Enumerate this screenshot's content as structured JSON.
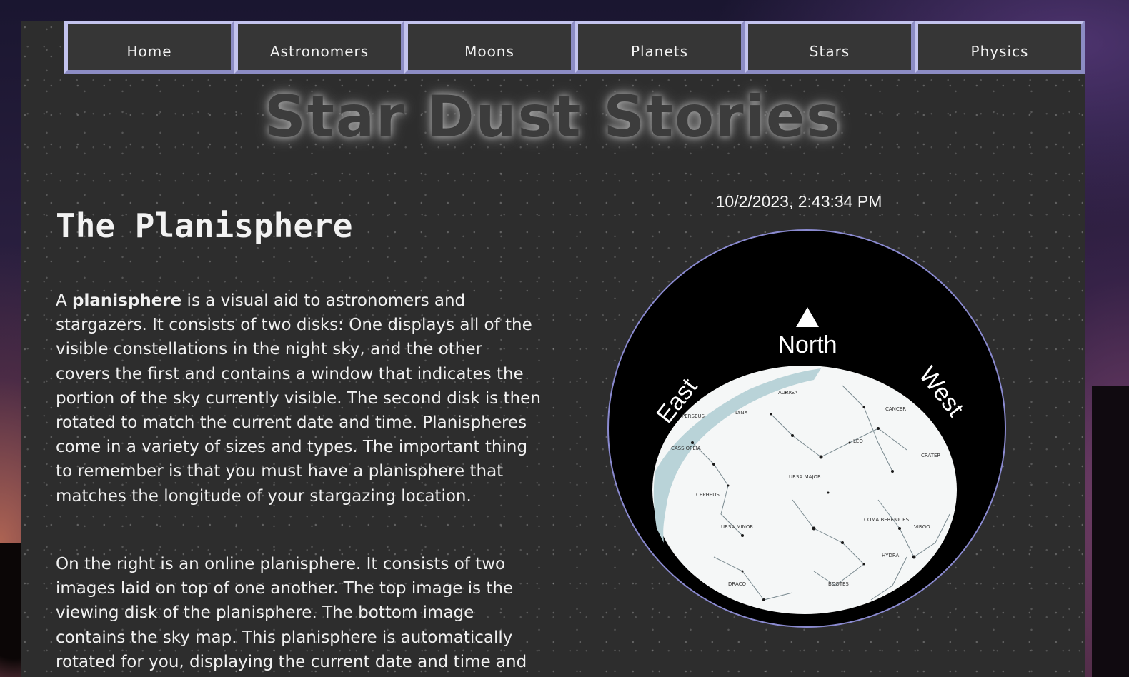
{
  "nav": {
    "items": [
      {
        "label": "Home"
      },
      {
        "label": "Astronomers"
      },
      {
        "label": "Moons"
      },
      {
        "label": "Planets"
      },
      {
        "label": "Stars"
      },
      {
        "label": "Physics"
      }
    ]
  },
  "site": {
    "title": "Star Dust Stories"
  },
  "article": {
    "heading": "The Planisphere",
    "para1_lead": "A ",
    "para1_term": "planisphere",
    "para1_rest": " is a visual aid to astronomers and stargazers. It consists of two disks: One displays all of the visible constellations in the night sky, and the other covers the first and contains a window that indicates the portion of the sky currently visible. The second disk is then rotated to match the current date and time. Planispheres come in a variety of sizes and types. The important thing to remember is that you must have a planisphere that matches the longitude of your stargazing location.",
    "para2": "On the right is an online planisphere. It consists of two images laid on top of one another. The top image is the viewing disk of the planisphere. The bottom image contains the sky map. This planisphere is automatically rotated for you, displaying the current date and time and visible constellations for observers at a longitude of"
  },
  "planisphere": {
    "datetime": "10/2/2023, 2:43:34 PM",
    "north_label": "North",
    "east_label": "East",
    "west_label": "West",
    "constellations": [
      "PERSEUS",
      "LYNX",
      "AURIGA",
      "CASSIOPEIA",
      "CEPHEUS",
      "URSA MAJOR",
      "URSA MINOR",
      "DRACO",
      "BOOTES",
      "COMA BERENICES",
      "CRATER",
      "HYDRA",
      "VIRGO",
      "LEO",
      "CANCER"
    ]
  },
  "colors": {
    "page_bg": "#2d2d2d",
    "nav_border": "#c3c3ee",
    "text": "#f0f0f0",
    "milky_way": "#b9d3d8"
  }
}
